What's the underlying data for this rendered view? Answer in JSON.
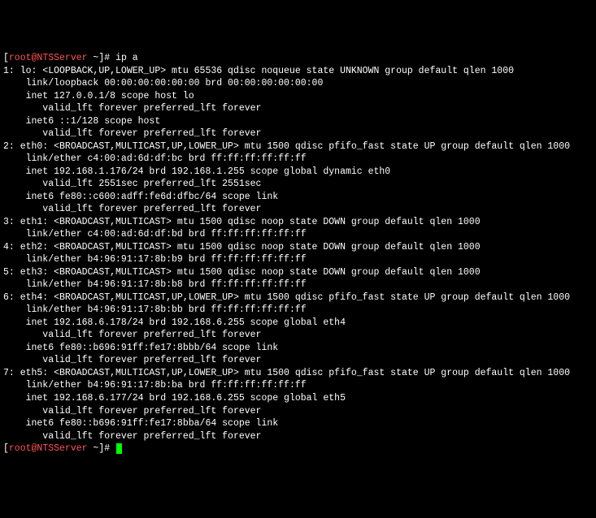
{
  "prompt": {
    "open": "[",
    "user_host": "root@NTSServer",
    "path": " ~",
    "close": "]# "
  },
  "command": "ip a",
  "output_lines": [
    "1: lo: <LOOPBACK,UP,LOWER_UP> mtu 65536 qdisc noqueue state UNKNOWN group default qlen 1000",
    "    link/loopback 00:00:00:00:00:00 brd 00:00:00:00:00:00",
    "    inet 127.0.0.1/8 scope host lo",
    "       valid_lft forever preferred_lft forever",
    "    inet6 ::1/128 scope host",
    "       valid_lft forever preferred_lft forever",
    "2: eth0: <BROADCAST,MULTICAST,UP,LOWER_UP> mtu 1500 qdisc pfifo_fast state UP group default qlen 1000",
    "    link/ether c4:00:ad:6d:df:bc brd ff:ff:ff:ff:ff:ff",
    "    inet 192.168.1.176/24 brd 192.168.1.255 scope global dynamic eth0",
    "       valid_lft 2551sec preferred_lft 2551sec",
    "    inet6 fe80::c600:adff:fe6d:dfbc/64 scope link",
    "       valid_lft forever preferred_lft forever",
    "3: eth1: <BROADCAST,MULTICAST> mtu 1500 qdisc noop state DOWN group default qlen 1000",
    "    link/ether c4:00:ad:6d:df:bd brd ff:ff:ff:ff:ff:ff",
    "4: eth2: <BROADCAST,MULTICAST> mtu 1500 qdisc noop state DOWN group default qlen 1000",
    "    link/ether b4:96:91:17:8b:b9 brd ff:ff:ff:ff:ff:ff",
    "5: eth3: <BROADCAST,MULTICAST> mtu 1500 qdisc noop state DOWN group default qlen 1000",
    "    link/ether b4:96:91:17:8b:b8 brd ff:ff:ff:ff:ff:ff",
    "6: eth4: <BROADCAST,MULTICAST,UP,LOWER_UP> mtu 1500 qdisc pfifo_fast state UP group default qlen 1000",
    "    link/ether b4:96:91:17:8b:bb brd ff:ff:ff:ff:ff:ff",
    "    inet 192.168.6.178/24 brd 192.168.6.255 scope global eth4",
    "       valid_lft forever preferred_lft forever",
    "    inet6 fe80::b696:91ff:fe17:8bbb/64 scope link",
    "       valid_lft forever preferred_lft forever",
    "7: eth5: <BROADCAST,MULTICAST,UP,LOWER_UP> mtu 1500 qdisc pfifo_fast state UP group default qlen 1000",
    "    link/ether b4:96:91:17:8b:ba brd ff:ff:ff:ff:ff:ff",
    "    inet 192.168.6.177/24 brd 192.168.6.255 scope global eth5",
    "       valid_lft forever preferred_lft forever",
    "    inet6 fe80::b696:91ff:fe17:8bba/64 scope link",
    "       valid_lft forever preferred_lft forever"
  ]
}
